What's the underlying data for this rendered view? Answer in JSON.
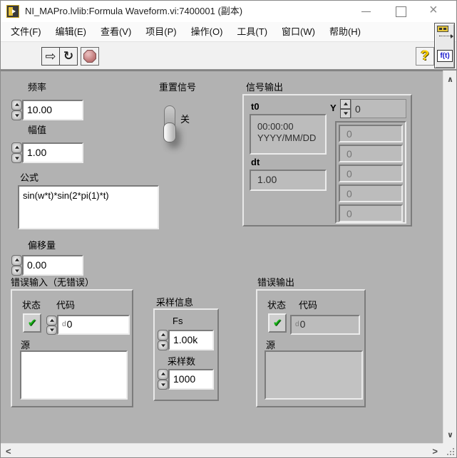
{
  "window": {
    "title": "NI_MAPro.lvlib:Formula Waveform.vi:7400001 (副本)"
  },
  "menu": {
    "items": [
      "文件(F)",
      "编辑(E)",
      "查看(V)",
      "项目(P)",
      "操作(O)",
      "工具(T)",
      "窗口(W)",
      "帮助(H)"
    ]
  },
  "vi_icon": {
    "label": "f(t)"
  },
  "panel": {
    "frequency": {
      "label": "频率",
      "value": "10.00"
    },
    "amplitude": {
      "label": "幅值",
      "value": "1.00"
    },
    "formula": {
      "label": "公式",
      "value": "sin(w*t)*sin(2*pi(1)*t)"
    },
    "reset": {
      "label": "重置信号",
      "state_label": "关"
    },
    "signal_output": {
      "label": "信号输出",
      "t0_label": "t0",
      "t0_time": "00:00:00",
      "t0_date": "YYYY/MM/DD",
      "dt_label": "dt",
      "dt_value": "1.00",
      "y_label": "Y",
      "y_index": "0",
      "y_values": [
        "0",
        "0",
        "0",
        "0",
        "0"
      ]
    },
    "offset": {
      "label": "偏移量",
      "value": "0.00"
    },
    "error_in": {
      "label": "错误输入（无错误）",
      "status_label": "状态",
      "code_label": "代码",
      "radix": "d",
      "code_value": "0",
      "source_label": "源",
      "source_value": ""
    },
    "sampling": {
      "label": "采样信息",
      "fs_label": "Fs",
      "fs_value": "1.00k",
      "samples_label": "采样数",
      "samples_value": "1000"
    },
    "error_out": {
      "label": "错误输出",
      "status_label": "状态",
      "code_label": "代码",
      "radix": "d",
      "code_value": "0",
      "source_label": "源",
      "source_value": ""
    }
  },
  "colors": {
    "panel_bg": "#b2b2b2",
    "accent_yellow": "#ffd400",
    "check_green": "#17b117",
    "ft_blue": "#1414cc",
    "abort_red": "#c47e7e"
  }
}
